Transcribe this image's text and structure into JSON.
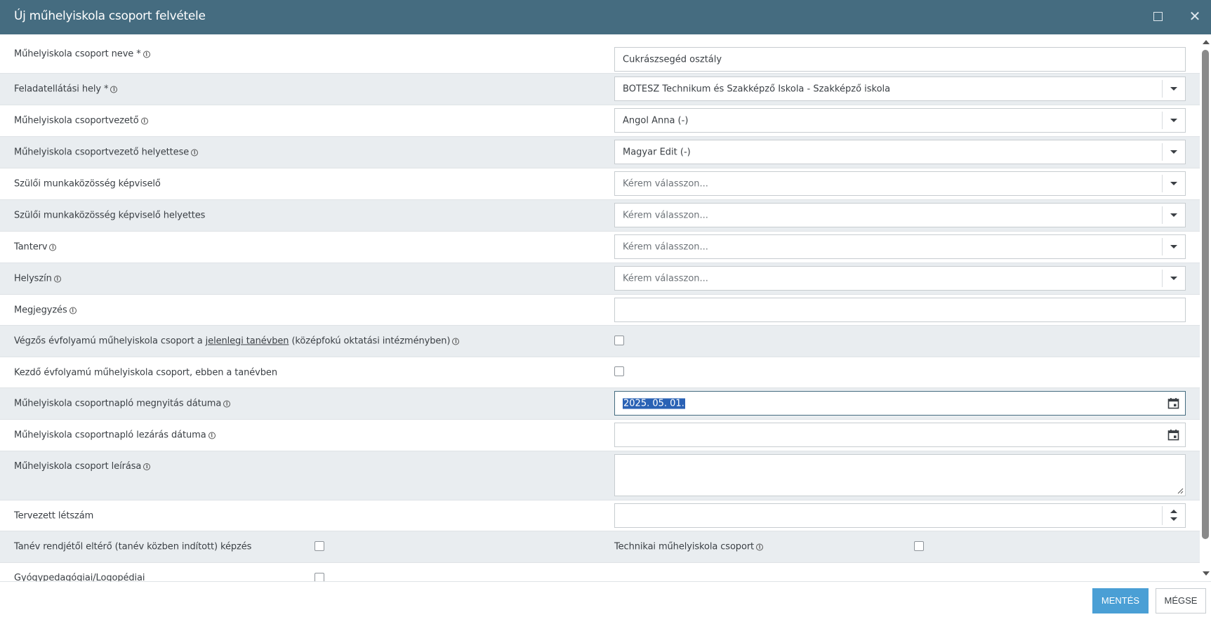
{
  "window": {
    "title": "Új műhelyiskola csoport felvétele",
    "maximize_icon": "maximize-icon",
    "close_icon": "close-icon"
  },
  "form": {
    "group_name": {
      "label": "Műhelyiskola csoport neve *",
      "value": "Cukrászsegéd osztály"
    },
    "location_service": {
      "label": "Feladatellátási hely *",
      "value": "BOTESZ Technikum és Szakképző Iskola - Szakképző iskola"
    },
    "group_leader": {
      "label": "Műhelyiskola csoportvezető",
      "value": "Angol Anna (-)"
    },
    "group_leader_deputy": {
      "label": "Műhelyiskola csoportvezető helyettese",
      "value": "Magyar Edit (-)"
    },
    "parent_rep": {
      "label": "Szülői munkaközösség képviselő",
      "placeholder": "Kérem válasszon..."
    },
    "parent_rep_deputy": {
      "label": "Szülői munkaközösség képviselő helyettes",
      "placeholder": "Kérem válasszon..."
    },
    "curriculum": {
      "label": "Tanterv",
      "placeholder": "Kérem válasszon..."
    },
    "venue": {
      "label": "Helyszín",
      "placeholder": "Kérem válasszon..."
    },
    "note": {
      "label": "Megjegyzés",
      "value": ""
    },
    "final_year": {
      "label_pre": "Végzős évfolyamú műhelyiskola csoport a ",
      "label_link": "jelenlegi tanévben",
      "label_post": " (középfokú oktatási intézményben)"
    },
    "first_year": {
      "label": "Kezdő évfolyamú műhelyiskola csoport, ebben a tanévben"
    },
    "log_open_date": {
      "label": "Műhelyiskola csoportnapló megnyitás dátuma",
      "value": "2025. 05. 01."
    },
    "log_close_date": {
      "label": "Műhelyiskola csoportnapló lezárás dátuma",
      "value": ""
    },
    "description": {
      "label": "Műhelyiskola csoport leírása",
      "value": ""
    },
    "planned_headcount": {
      "label": "Tervezett létszám",
      "value": ""
    },
    "off_schedule": {
      "label": "Tanév rendjétől eltérő (tanév közben indított) képzés"
    },
    "technical_group": {
      "label": "Technikai műhelyiskola csoport"
    },
    "special_needs": {
      "label": "Gyógypedagógiai/Logopédiai"
    }
  },
  "footer": {
    "save_label": "MENTÉS",
    "cancel_label": "MÉGSE"
  },
  "colors": {
    "titlebar": "#456c80",
    "primary_button": "#4a9fd5",
    "alt_row": "#e9edf0"
  }
}
